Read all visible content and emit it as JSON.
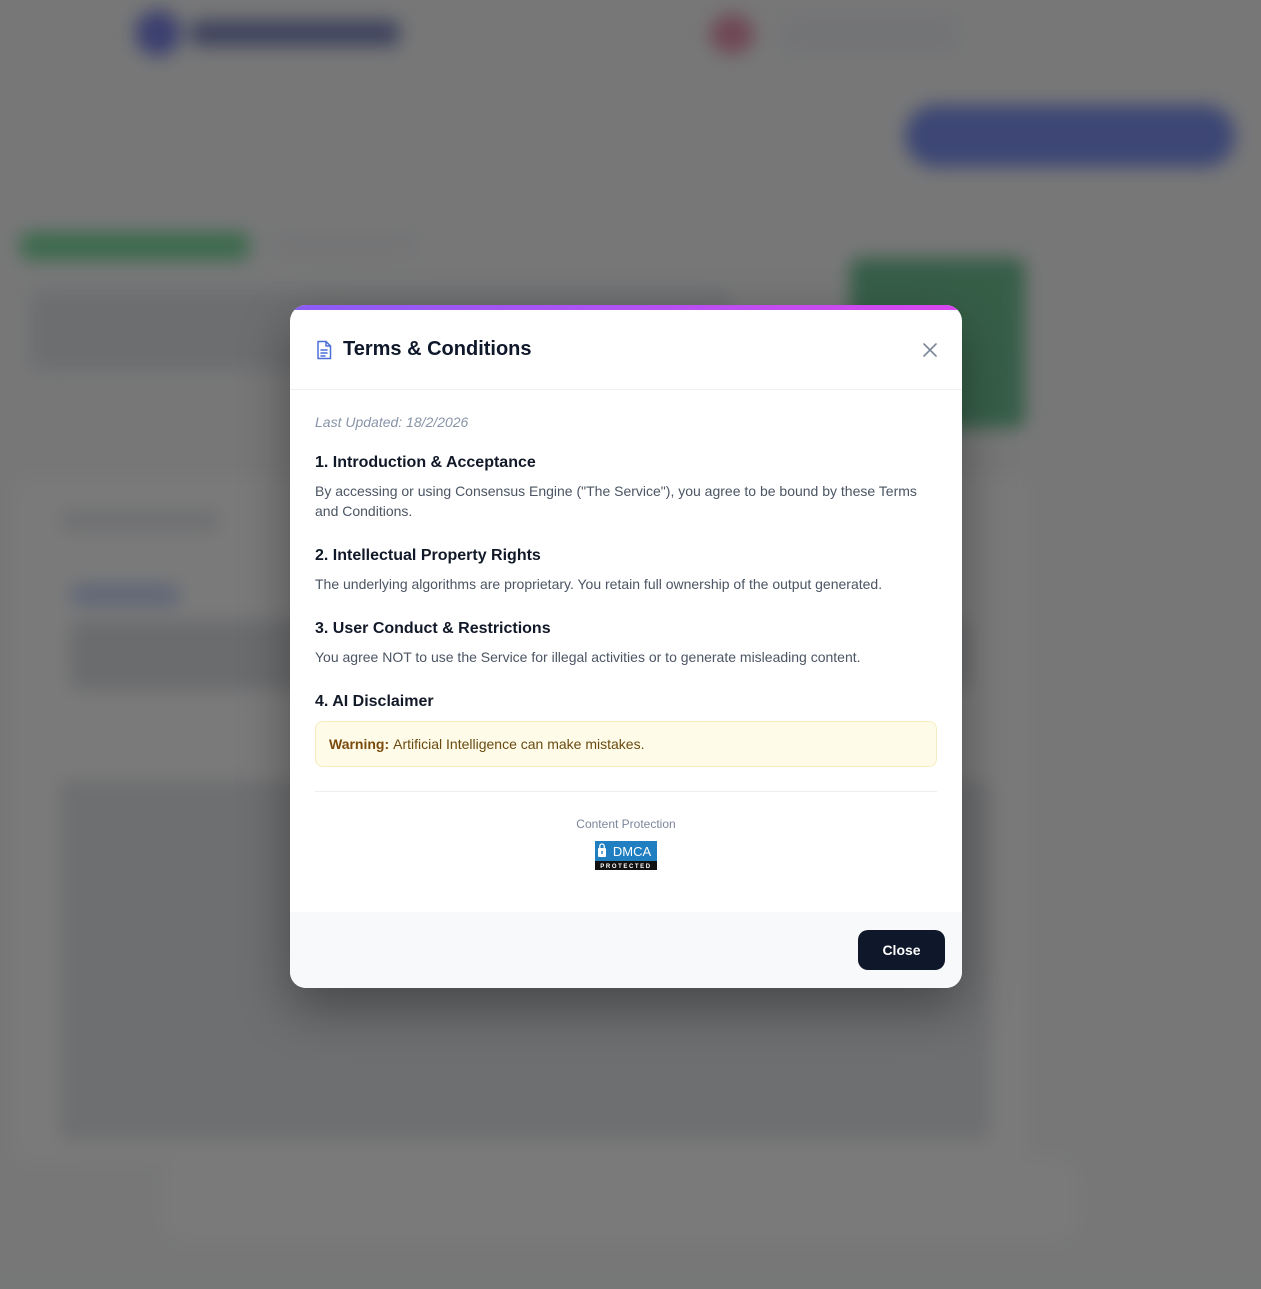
{
  "modal": {
    "title": "Terms & Conditions",
    "last_updated": "Last Updated: 18/2/2026",
    "sections": [
      {
        "title": "1. Introduction & Acceptance",
        "text": "By accessing or using Consensus Engine (\"The Service\"), you agree to be bound by these Terms and Conditions."
      },
      {
        "title": "2. Intellectual Property Rights",
        "text": "The underlying algorithms are proprietary. You retain full ownership of the output generated."
      },
      {
        "title": "3. User Conduct & Restrictions",
        "text": "You agree NOT to use the Service for illegal activities or to generate misleading content."
      },
      {
        "title": "4. AI Disclaimer",
        "warning_label": "Warning:",
        "warning_text": "Artificial Intelligence can make mistakes."
      }
    ],
    "protection_label": "Content Protection",
    "dmca_badge": {
      "top": "DMCA",
      "bottom": "PROTECTED"
    },
    "close_button": "Close"
  },
  "icons": {
    "title_icon": "document-icon",
    "close_icon": "close-icon",
    "badge_icon": "lock-icon"
  },
  "colors": {
    "accent_start": "#8b5cf6",
    "accent_end": "#d946ef",
    "button_bg": "#0f172a",
    "warning_bg": "#fefbe8",
    "warning_text": "#7a4b0c",
    "dmca_blue": "#1f7fc1"
  }
}
